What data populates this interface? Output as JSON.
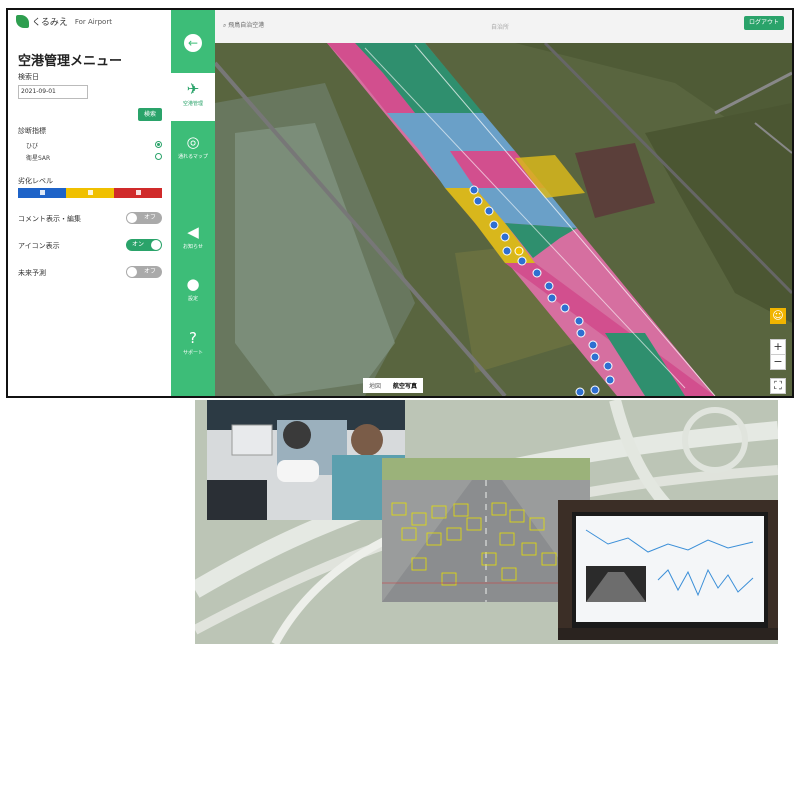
{
  "brand": {
    "logo_text": "くるみえ",
    "logo_sub": "For Airport"
  },
  "menu": {
    "title": "空港管理メニュー",
    "date_label": "検索日",
    "date_value": "2021-09-01",
    "search_button": "検索",
    "indicator_label": "診断指標",
    "indicators": [
      {
        "label": "ひび",
        "selected": true
      },
      {
        "label": "衛星SAR",
        "selected": false
      }
    ],
    "level_label": "劣化レベル",
    "level_colors": [
      "#1e63c8",
      "#f0c000",
      "#d02a2a"
    ],
    "toggles": [
      {
        "label": "コメント表示・編集",
        "state": "オフ",
        "on": false
      },
      {
        "label": "アイコン表示",
        "state": "オン",
        "on": true
      },
      {
        "label": "未来予測",
        "state": "オフ",
        "on": false
      }
    ]
  },
  "nav": {
    "items": [
      {
        "label": "空港管理",
        "icon": "runway-icon"
      },
      {
        "label": "通れるマップ",
        "icon": "map-pin-icon"
      },
      {
        "label": "お知らせ",
        "icon": "megaphone-icon"
      },
      {
        "label": "設定",
        "icon": "user-icon"
      },
      {
        "label": "サポート",
        "icon": "support-icon"
      }
    ]
  },
  "header": {
    "search_text": "飛鳥自治空港",
    "center_text": "自治所",
    "logout": "ログアウト"
  },
  "map": {
    "tabs": [
      "地図",
      "航空写真"
    ],
    "selected_tab": "航空写真",
    "zoom_in": "+",
    "zoom_out": "−",
    "segment_colors": {
      "teal": "#2f8f6e",
      "pink": "#d24f8e",
      "blue": "#6aa0c8",
      "yellow": "#d8b71c"
    }
  },
  "colors": {
    "accent": "#3dbd78",
    "button": "#2aa36a"
  }
}
